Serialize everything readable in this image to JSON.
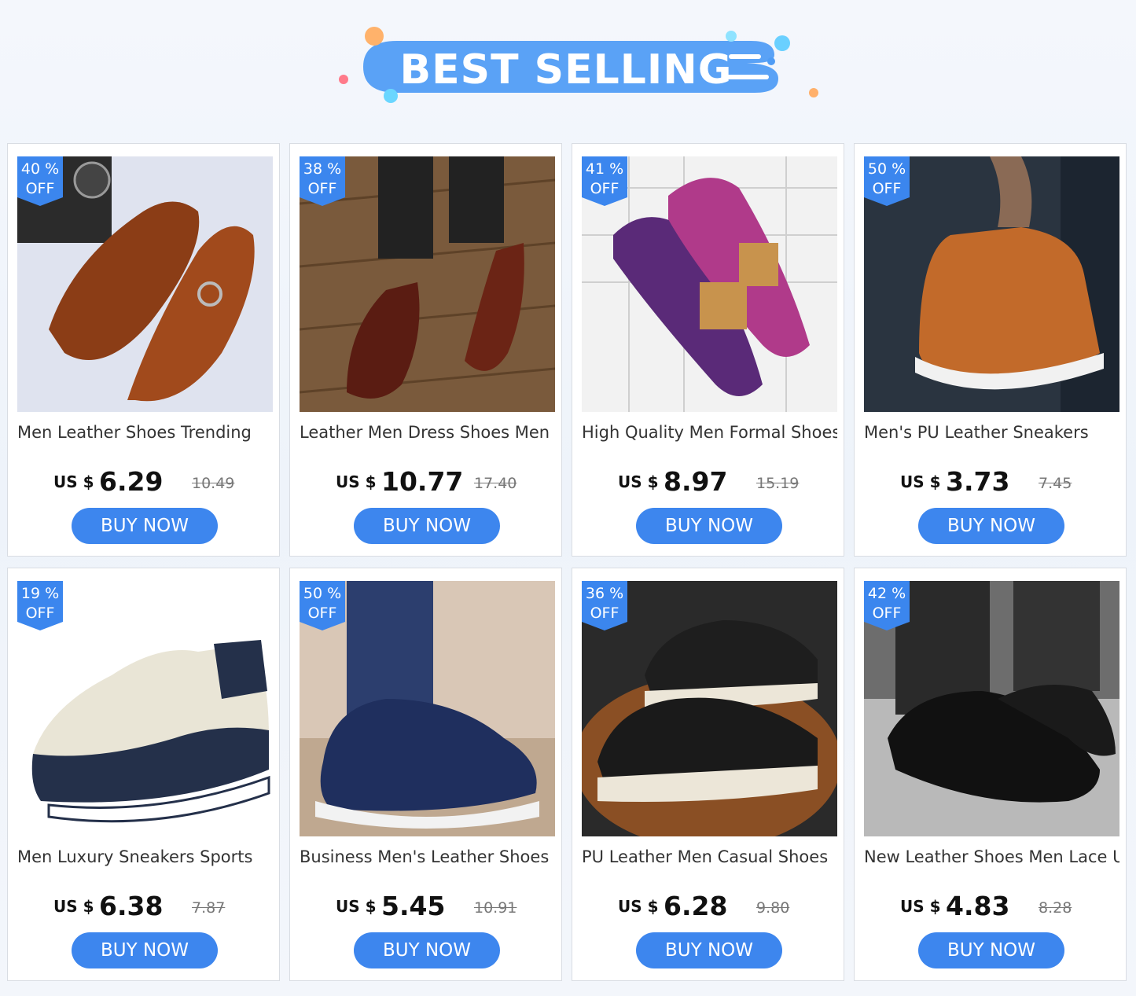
{
  "header": {
    "title": "BEST SELLING"
  },
  "colors": {
    "accent": "#3d86ee",
    "banner_blue": "#4f9cf5",
    "badge_blue": "#3b86ee"
  },
  "products": [
    {
      "discount": "40 %",
      "off": "OFF",
      "title": "Men Leather Shoes Trending",
      "currency": "US $",
      "price": "6.29",
      "old_price": "10.49",
      "buy_label": "BUY NOW",
      "image": "brown-monk-strap-dress-shoes"
    },
    {
      "discount": "38 %",
      "off": "OFF",
      "title": "Leather Men Dress Shoes Men",
      "currency": "US $",
      "price": "10.77",
      "old_price": "17.40",
      "buy_label": "BUY NOW",
      "image": "burgundy-double-monk-shoes"
    },
    {
      "discount": "41 %",
      "off": "OFF",
      "title": "High Quality Men Formal Shoes",
      "currency": "US $",
      "price": "8.97",
      "old_price": "15.19",
      "buy_label": "BUY NOW",
      "image": "floral-print-loafers"
    },
    {
      "discount": "50 %",
      "off": "OFF",
      "title": "Men's PU Leather Sneakers",
      "currency": "US $",
      "price": "3.73",
      "old_price": "7.45",
      "buy_label": "BUY NOW",
      "image": "orange-leather-sneakers"
    },
    {
      "discount": "19 %",
      "off": "OFF",
      "title": "Men Luxury Sneakers Sports",
      "currency": "US $",
      "price": "6.38",
      "old_price": "7.87",
      "buy_label": "BUY NOW",
      "image": "navy-cream-running-sneaker"
    },
    {
      "discount": "50 %",
      "off": "OFF",
      "title": "Business Men's Leather Shoes",
      "currency": "US $",
      "price": "5.45",
      "old_price": "10.91",
      "buy_label": "BUY NOW",
      "image": "navy-leather-sneaker-on-foot"
    },
    {
      "discount": "36 %",
      "off": "OFF",
      "title": "PU Leather Men Casual Shoes",
      "currency": "US $",
      "price": "6.28",
      "old_price": "9.80",
      "buy_label": "BUY NOW",
      "image": "black-casual-sneakers"
    },
    {
      "discount": "42 %",
      "off": "OFF",
      "title": "New Leather Shoes Men Lace Up",
      "currency": "US $",
      "price": "4.83",
      "old_price": "8.28",
      "buy_label": "BUY NOW",
      "image": "black-patent-oxford-shoes"
    }
  ]
}
